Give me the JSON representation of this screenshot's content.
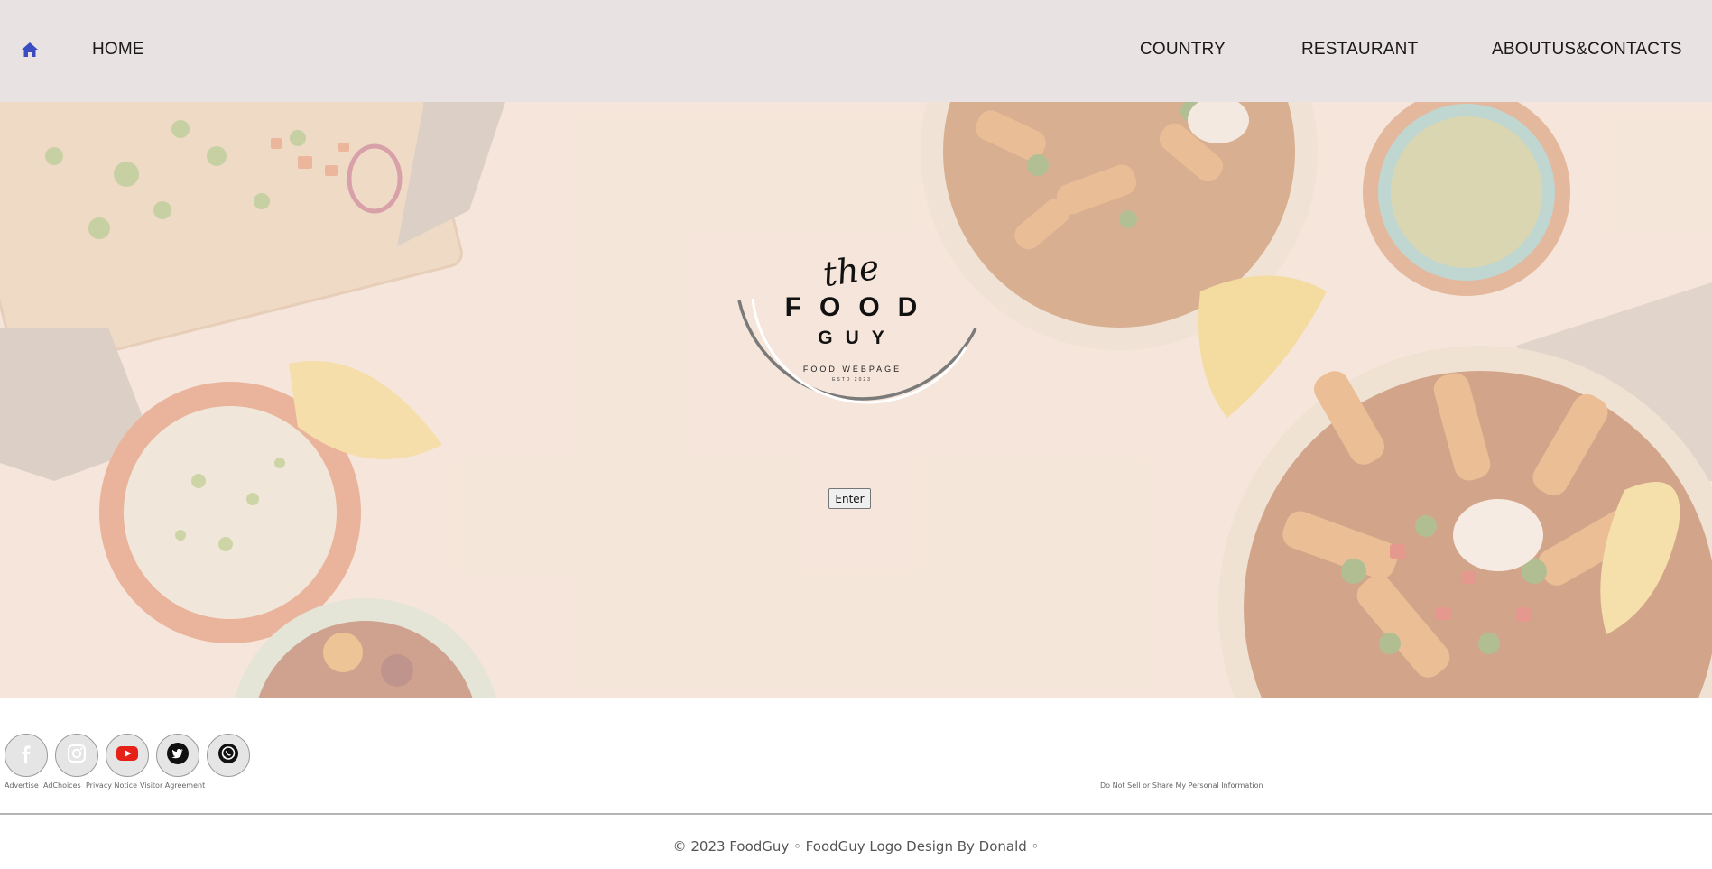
{
  "nav": {
    "home_icon": "home-icon",
    "home_label": "HOME",
    "country_label": "COUNTRY",
    "restaurant_label": "RESTAURANT",
    "about_label": "ABOUTUS&CONTACTS",
    "accent": "#3b4cc0"
  },
  "hero": {
    "logo": {
      "the": "the",
      "food": "FOOD",
      "guy": "GUY",
      "subtitle": "FOOD WEBPAGE",
      "est": "ESTD 2023"
    },
    "enter_label": "Enter"
  },
  "footer": {
    "social_icons": [
      "facebook-icon",
      "instagram-icon",
      "youtube-icon",
      "twitter-icon",
      "whatsapp-icon"
    ],
    "youtube_color": "#e62117",
    "links": {
      "advertise": "Advertise",
      "adchoices": "AdChoices",
      "privacy": "Privacy Notice",
      "visitor": "Visitor Agreement",
      "do_not_sell": "Do Not Sell or Share My Personal Information"
    },
    "copyright": "© 2023 FoodGuy ◦ FoodGuy Logo Design By Donald ◦"
  }
}
